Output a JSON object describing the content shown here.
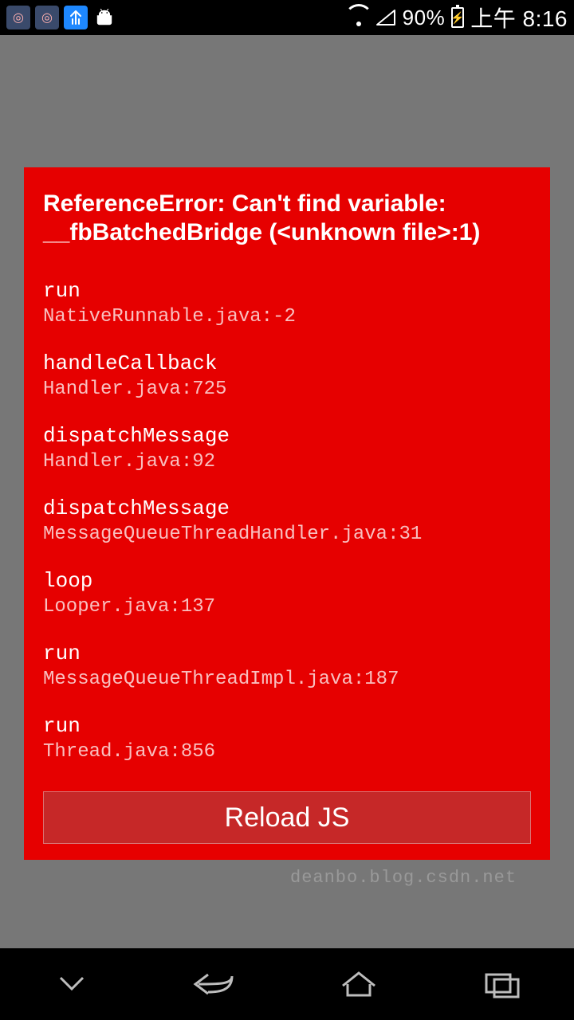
{
  "status_bar": {
    "battery_text": "90%",
    "time": "上午 8:16",
    "icons": {
      "wifi": "wifi-icon",
      "signal": "signal-icon",
      "battery": "battery-charging-icon"
    }
  },
  "error": {
    "title": "ReferenceError: Can't find variable: __fbBatchedBridge (<unknown file>:1)",
    "stack": [
      {
        "method": "run",
        "location": "NativeRunnable.java:-2"
      },
      {
        "method": "handleCallback",
        "location": "Handler.java:725"
      },
      {
        "method": "dispatchMessage",
        "location": "Handler.java:92"
      },
      {
        "method": "dispatchMessage",
        "location": "MessageQueueThreadHandler.java:31"
      },
      {
        "method": "loop",
        "location": "Looper.java:137"
      },
      {
        "method": "run",
        "location": "MessageQueueThreadImpl.java:187"
      },
      {
        "method": "run",
        "location": "Thread.java:856"
      }
    ],
    "reload_label": "Reload JS",
    "watermark": "deanbo.blog.csdn.net"
  },
  "nav": {
    "keyboard_hide": "keyboard-hide-icon",
    "back": "back-icon",
    "home": "home-icon",
    "recent": "recent-apps-icon"
  },
  "colors": {
    "error_bg": "#e60000",
    "reload_bg": "#c62828",
    "app_bg": "#777777"
  }
}
